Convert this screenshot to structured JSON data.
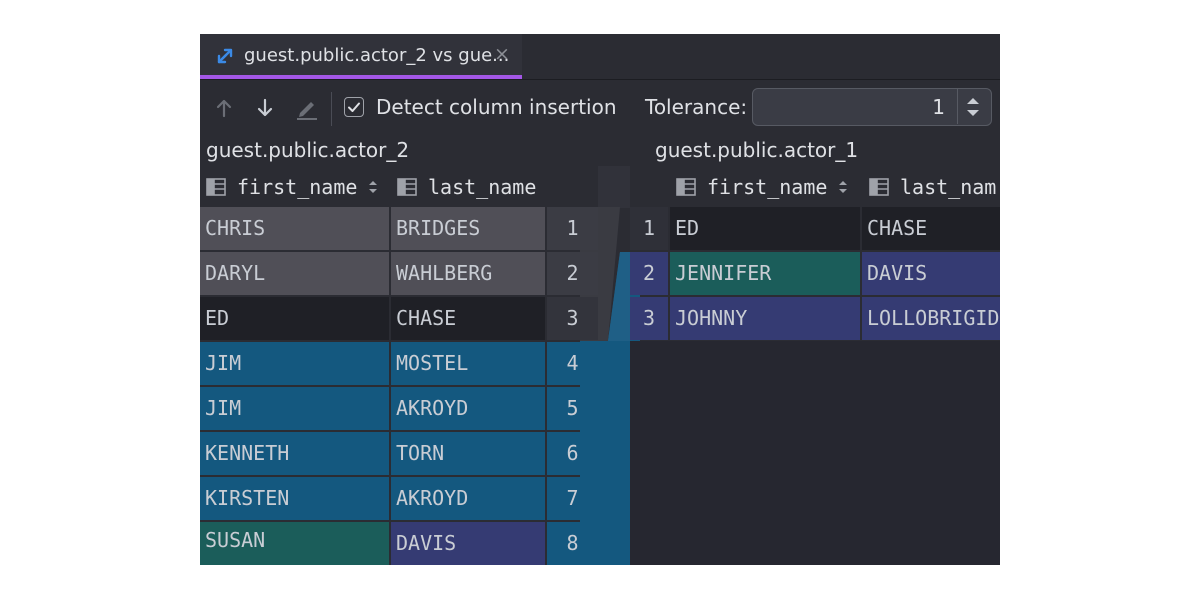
{
  "tab": {
    "title": "guest.public.actor_2 vs gue...",
    "close": "×"
  },
  "toolbar": {
    "detect_label": "Detect column insertion",
    "detect_checked": true,
    "tolerance_label": "Tolerance:",
    "tolerance_value": "1"
  },
  "left": {
    "title": "guest.public.actor_2",
    "columns": [
      "first_name",
      "last_name"
    ],
    "rows": [
      {
        "first_name": "CHRIS",
        "last_name": "BRIDGES",
        "num": "1"
      },
      {
        "first_name": "DARYL",
        "last_name": "WAHLBERG",
        "num": "2"
      },
      {
        "first_name": "ED",
        "last_name": "CHASE",
        "num": "3"
      },
      {
        "first_name": "JIM",
        "last_name": "MOSTEL",
        "num": "4"
      },
      {
        "first_name": "JIM",
        "last_name": "AKROYD",
        "num": "5"
      },
      {
        "first_name": "KENNETH",
        "last_name": "TORN",
        "num": "6"
      },
      {
        "first_name": "KIRSTEN",
        "last_name": "AKROYD",
        "num": "7"
      },
      {
        "first_name": "SUSAN",
        "last_name": "DAVIS",
        "num": "8"
      }
    ]
  },
  "right": {
    "title": "guest.public.actor_1",
    "columns": [
      "first_name",
      "last_nam"
    ],
    "rows": [
      {
        "num": "1",
        "first_name": "ED",
        "last_name": "CHASE"
      },
      {
        "num": "2",
        "first_name": "JENNIFER",
        "last_name": "DAVIS"
      },
      {
        "num": "3",
        "first_name": "JOHNNY",
        "last_name": "LOLLOBRIGID"
      }
    ]
  },
  "colors": {
    "background": "#2b2c33",
    "removed": "#504f57",
    "unchanged": "#1f2026",
    "inserted": "#14587f",
    "modified": "#1b5d5a",
    "changed_value": "#353b73",
    "accent": "#a357e6",
    "icon_blue": "#3b8ae6"
  }
}
